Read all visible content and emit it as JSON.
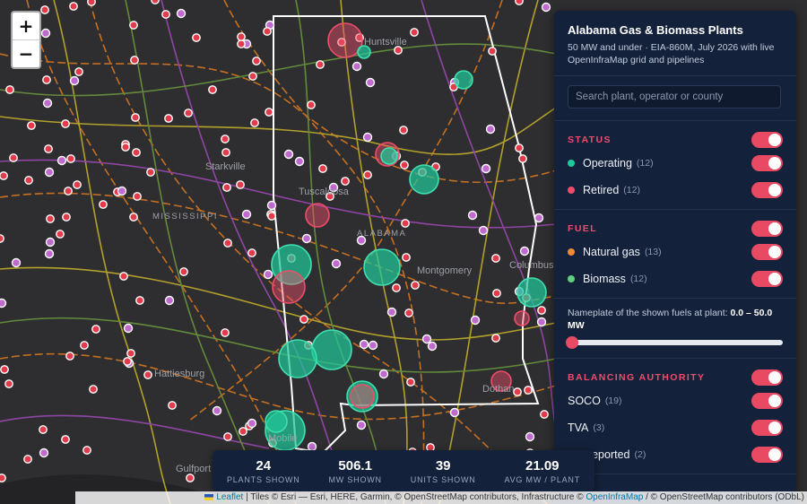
{
  "map": {
    "city_labels": [
      {
        "name": "Huntsville"
      },
      {
        "name": "Starkville"
      },
      {
        "name": "Tuscaloosa"
      },
      {
        "name": "MISSISSIPPI"
      },
      {
        "name": "ALABAMA"
      },
      {
        "name": "Montgomery"
      },
      {
        "name": "Columbus"
      },
      {
        "name": "Hattiesburg"
      },
      {
        "name": "Mobile"
      },
      {
        "name": "Gulfport"
      },
      {
        "name": "Dothan"
      }
    ],
    "colors": {
      "operating": "#21c89a",
      "retired": "#ef4d6a",
      "gas": "#f08a34",
      "biomass": "#5dd17d",
      "pipeline_orange": "#e07b20",
      "line_yellow": "#c9b52a",
      "line_purple": "#a04ab8",
      "line_green": "#6d9a3c"
    }
  },
  "zoom": {
    "in": "+",
    "out": "−"
  },
  "panel": {
    "title": "Alabama Gas & Biomass Plants",
    "subtitle": "50 MW and under · EIA-860M, July 2026 with live OpenInfraMap grid and pipelines",
    "search_placeholder": "Search plant, operator or county",
    "status": {
      "title": "STATUS",
      "items": [
        {
          "label": "Operating",
          "count": "(12)",
          "color": "#21c89a"
        },
        {
          "label": "Retired",
          "count": "(12)",
          "color": "#ef4d6a"
        }
      ]
    },
    "fuel": {
      "title": "FUEL",
      "items": [
        {
          "label": "Natural gas",
          "count": "(13)",
          "color": "#f08a34"
        },
        {
          "label": "Biomass",
          "count": "(12)",
          "color": "#5dd17d"
        }
      ]
    },
    "slider": {
      "label": "Nameplate of the shown fuels at plant:",
      "range": "0.0 – 50.0 MW",
      "value": 0.0
    },
    "ba": {
      "title": "BALANCING AUTHORITY",
      "items": [
        {
          "label": "SOCO",
          "count": "(19)"
        },
        {
          "label": "TVA",
          "count": "(3)"
        },
        {
          "label": "Not reported",
          "count": "(2)"
        }
      ]
    }
  },
  "stats": [
    {
      "value": "24",
      "label": "PLANTS SHOWN"
    },
    {
      "value": "506.1",
      "label": "MW SHOWN"
    },
    {
      "value": "39",
      "label": "UNITS SHOWN"
    },
    {
      "value": "21.09",
      "label": "AVG MW / PLANT"
    }
  ],
  "attribution": {
    "leaflet": "Leaflet",
    "tiles": " | Tiles © Esri — Esri, HERE, Garmin, © OpenStreetMap contributors, Infrastructure © ",
    "oim": "OpenInfraMap",
    "tail": " / © OpenStreetMap contributors (ODbL)"
  }
}
